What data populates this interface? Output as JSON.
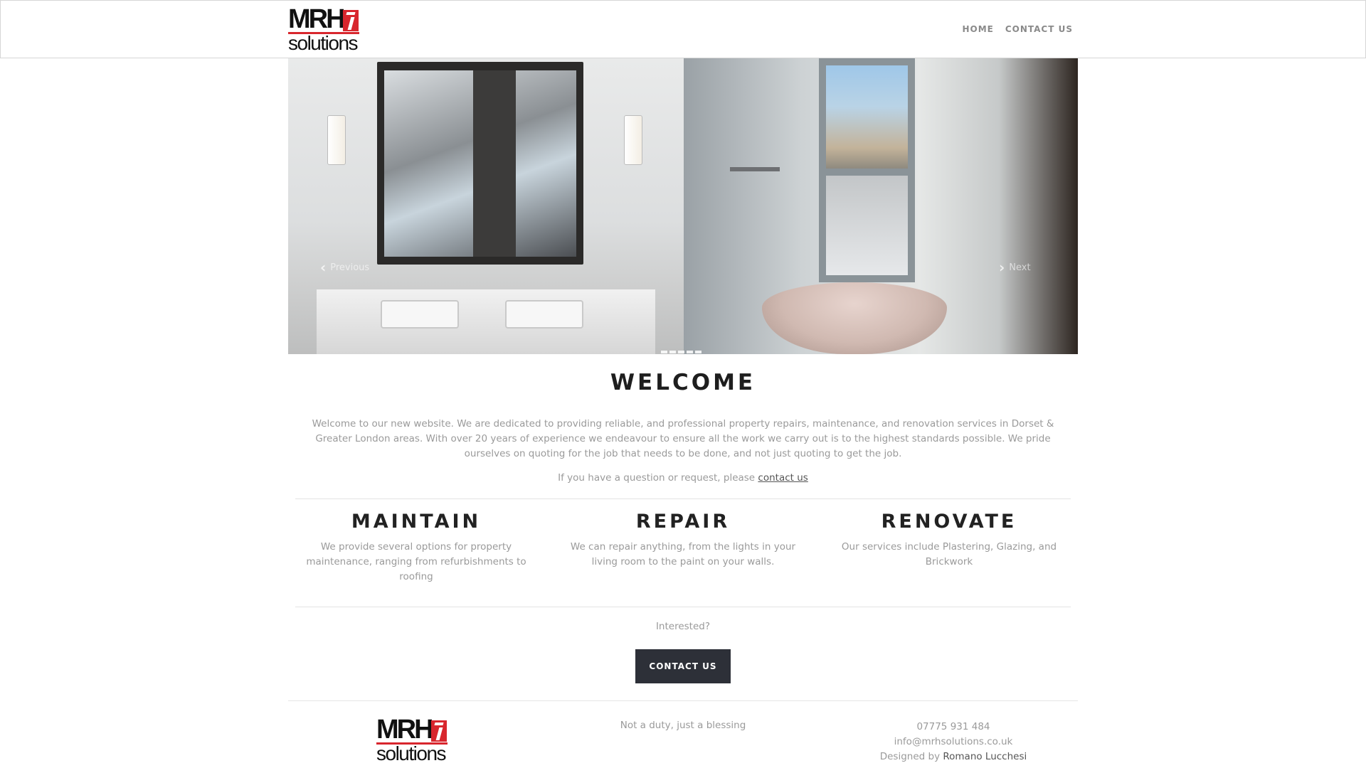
{
  "header": {
    "logo": {
      "top": "MRH",
      "bottom": "solutions"
    },
    "nav": [
      {
        "label": "HOME"
      },
      {
        "label": "CONTACT US"
      }
    ]
  },
  "carousel": {
    "prev_label": "Previous",
    "next_label": "Next",
    "indicator_count": 5
  },
  "welcome": {
    "title": "WELCOME",
    "body": "Welcome to our new website. We are dedicated to providing reliable, and professional property repairs, maintenance, and renovation services in Dorset & Greater London areas. With over 20 years of experience we endeavour to ensure all the work we carry out is to the highest standards possible. We pride ourselves on quoting for the job that needs to be done, and not just quoting to get the job.",
    "question_prefix": "If you have a question or request, please",
    "question_link": "contact us"
  },
  "features": [
    {
      "title": "MAINTAIN",
      "text": "We provide several options for property maintenance, ranging from refurbishments to roofing"
    },
    {
      "title": "REPAIR",
      "text": "We can repair anything, from the lights in your living room to the paint on your walls."
    },
    {
      "title": "RENOVATE",
      "text": "Our services include Plastering, Glazing, and Brickwork"
    }
  ],
  "cta": {
    "prompt": "Interested?",
    "button": "CONTACT US"
  },
  "footer": {
    "logo": {
      "top": "MRH",
      "bottom": "solutions"
    },
    "tagline": "Not a duty, just a blessing",
    "phone": "07775 931 484",
    "email": "info@mrhsolutions.co.uk",
    "designed_prefix": "Designed by",
    "designer": "Romano Lucchesi"
  },
  "colors": {
    "brand_red": "#d8262d",
    "button_dark": "#2d3038"
  }
}
